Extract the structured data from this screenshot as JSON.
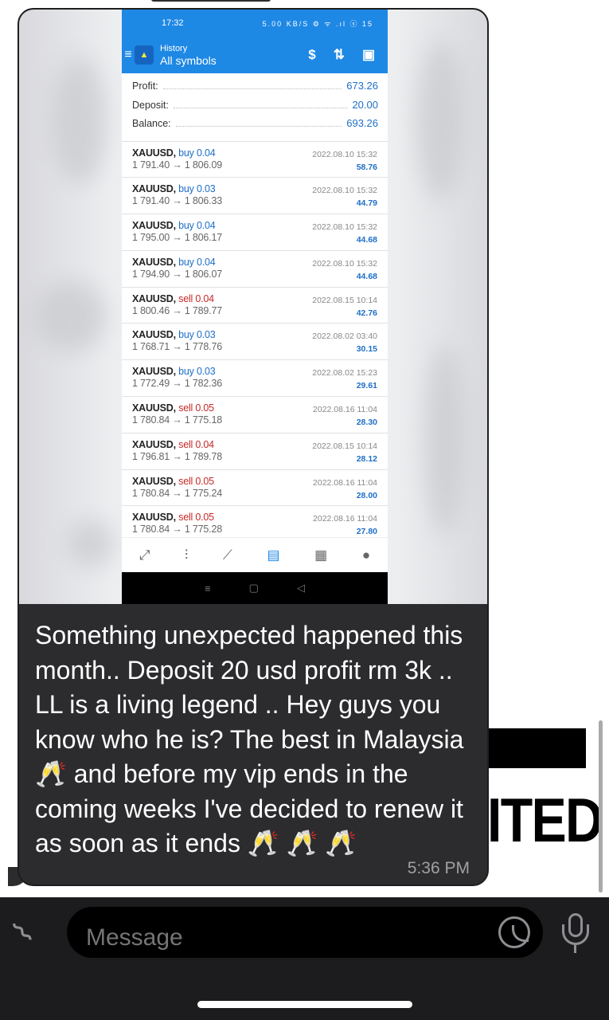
{
  "screen": {
    "background_text": "ITED"
  },
  "shared_image": {
    "status_bar": {
      "time": "17:32",
      "icons": "5.00 KB/S ⚙ ᯤ .ıl ⓢ 15"
    },
    "app_bar": {
      "title_small": "History",
      "title_big": "All symbols"
    },
    "summary": [
      {
        "label": "Profit:",
        "value": "673.26"
      },
      {
        "label": "Deposit:",
        "value": "20.00"
      },
      {
        "label": "Balance:",
        "value": "693.26"
      }
    ],
    "trades": [
      {
        "symbol": "XAUUSD,",
        "side": "buy",
        "lots": "0.04",
        "prices": "1 791.40 → 1 806.09",
        "date": "2022.08.10 15:32",
        "profit": "58.76"
      },
      {
        "symbol": "XAUUSD,",
        "side": "buy",
        "lots": "0.03",
        "prices": "1 791.40 → 1 806.33",
        "date": "2022.08.10 15:32",
        "profit": "44.79"
      },
      {
        "symbol": "XAUUSD,",
        "side": "buy",
        "lots": "0.04",
        "prices": "1 795.00 → 1 806.17",
        "date": "2022.08.10 15:32",
        "profit": "44.68"
      },
      {
        "symbol": "XAUUSD,",
        "side": "buy",
        "lots": "0.04",
        "prices": "1 794.90 → 1 806.07",
        "date": "2022.08.10 15:32",
        "profit": "44.68"
      },
      {
        "symbol": "XAUUSD,",
        "side": "sell",
        "lots": "0.04",
        "prices": "1 800.46 → 1 789.77",
        "date": "2022.08.15 10:14",
        "profit": "42.76"
      },
      {
        "symbol": "XAUUSD,",
        "side": "buy",
        "lots": "0.03",
        "prices": "1 768.71 → 1 778.76",
        "date": "2022.08.02 03:40",
        "profit": "30.15"
      },
      {
        "symbol": "XAUUSD,",
        "side": "buy",
        "lots": "0.03",
        "prices": "1 772.49 → 1 782.36",
        "date": "2022.08.02 15:23",
        "profit": "29.61"
      },
      {
        "symbol": "XAUUSD,",
        "side": "sell",
        "lots": "0.05",
        "prices": "1 780.84 → 1 775.18",
        "date": "2022.08.16 11:04",
        "profit": "28.30"
      },
      {
        "symbol": "XAUUSD,",
        "side": "sell",
        "lots": "0.04",
        "prices": "1 796.81 → 1 789.78",
        "date": "2022.08.15 10:14",
        "profit": "28.12"
      },
      {
        "symbol": "XAUUSD,",
        "side": "sell",
        "lots": "0.05",
        "prices": "1 780.84 → 1 775.24",
        "date": "2022.08.16 11:04",
        "profit": "28.00"
      },
      {
        "symbol": "XAUUSD,",
        "side": "sell",
        "lots": "0.05",
        "prices": "1 780.84 → 1 775.28",
        "date": "2022.08.16 11:04",
        "profit": "27.80"
      }
    ],
    "toolbar_icons": [
      "trade-icon",
      "chart-candles-icon",
      "trend-icon",
      "history-icon",
      "news-icon",
      "chat-icon"
    ],
    "nav_icons": [
      "menu-icon",
      "home-icon",
      "back-icon"
    ]
  },
  "message": {
    "text": "Something unexpected happened this month.. Deposit 20 usd profit rm 3k .. LL is a living legend .. Hey guys you know who he is? The best in Malaysia 🥂 and before my vip ends in the coming weeks I've decided to renew it as soon as it ends 🥂 🥂 🥂",
    "time": "5:36 PM"
  },
  "input_bar": {
    "placeholder": "Message"
  },
  "colors": {
    "mt_blue": "#1e88e5",
    "profit_blue": "#1e6fc7",
    "sell_red": "#c62828",
    "bubble": "#2c2c2e"
  }
}
